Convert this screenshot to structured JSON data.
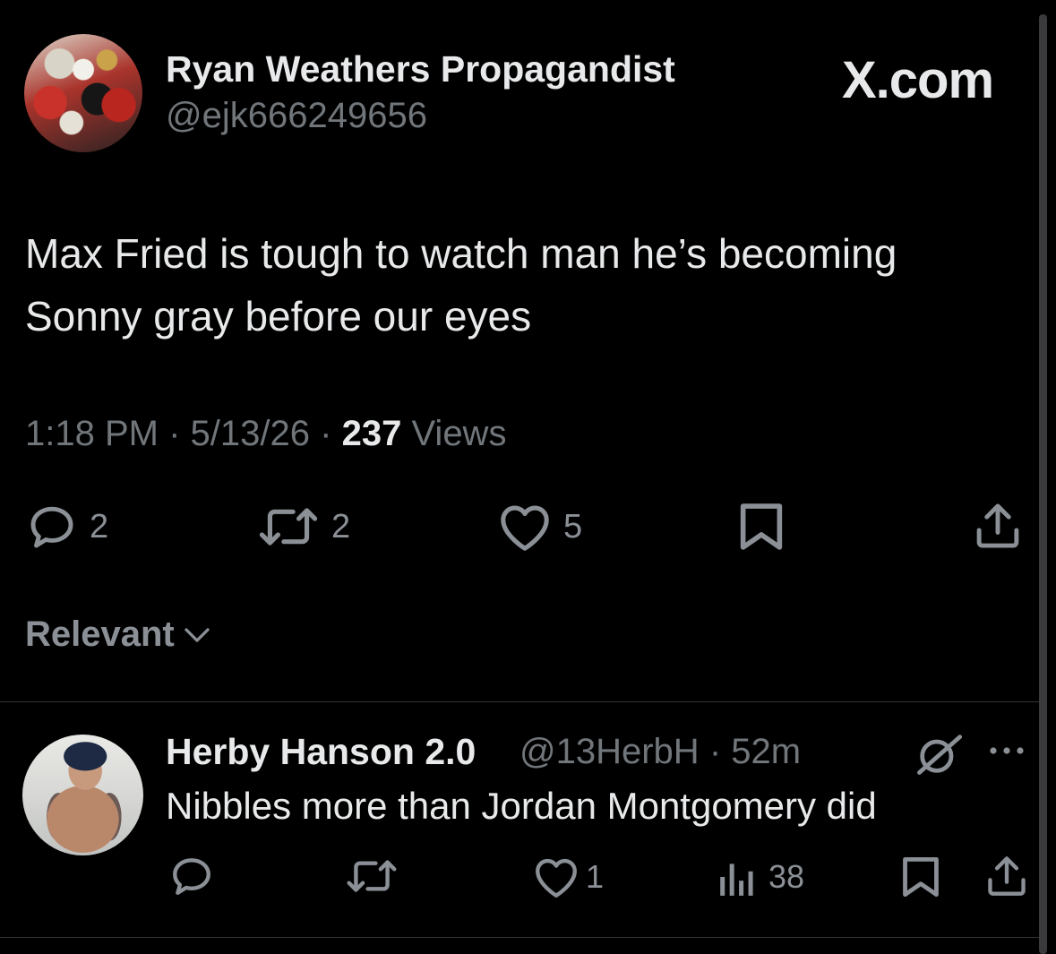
{
  "brand": "X.com",
  "tweet": {
    "display_name": "Ryan Weathers Propagandist",
    "handle": "@ejk666249656",
    "text_line1": "Max Fried is tough to watch man he’s becoming",
    "text_line2": "Sonny gray before our eyes",
    "time": "1:18 PM",
    "date": "5/13/26",
    "separator": "·",
    "views_count": "237",
    "views_label": "Views",
    "actions": {
      "replies": "2",
      "reposts": "2",
      "likes": "5"
    }
  },
  "sort": {
    "label": "Relevant"
  },
  "reply": {
    "display_name": "Herby Hanson 2.0",
    "handle": "@13HerbH",
    "separator": "·",
    "age": "52m",
    "text": "Nibbles more than Jordan Montgomery did",
    "actions": {
      "likes": "1",
      "views": "38"
    }
  },
  "icons": {
    "reply": "reply-bubble-icon",
    "repost": "repost-icon",
    "like": "heart-icon",
    "bookmark": "bookmark-icon",
    "share": "share-icon",
    "views": "analytics-icon",
    "grok": "grok-icon",
    "more": "more-icon",
    "chevron": "chevron-down-icon"
  },
  "colors": {
    "background": "#000000",
    "text_primary": "#e7e9ea",
    "text_secondary": "#71767b",
    "icon": "#8b9096",
    "divider": "#2f3336"
  }
}
